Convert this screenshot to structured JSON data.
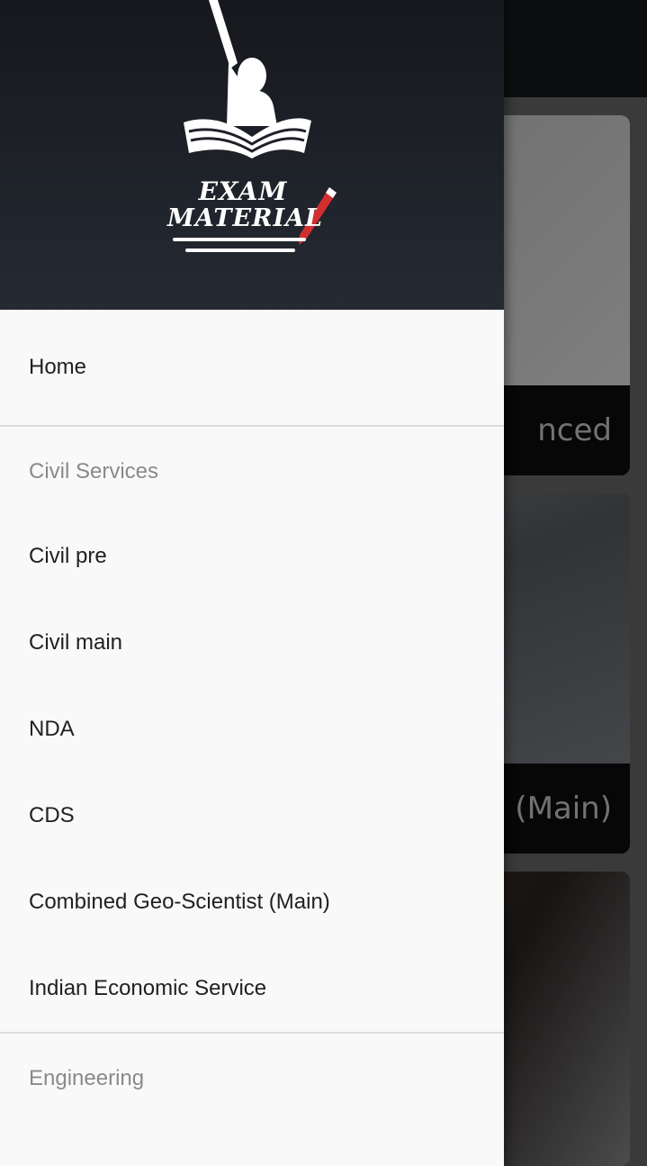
{
  "app": {
    "logo_text_line1": "EXAM",
    "logo_text_line2": "MATERIAL"
  },
  "background": {
    "cards": [
      {
        "caption": "nced"
      },
      {
        "caption": "es (Main)"
      },
      {
        "caption": ""
      }
    ]
  },
  "drawer": {
    "home_label": "Home",
    "sections": [
      {
        "title": "Civil Services",
        "items": [
          "Civil pre",
          "Civil main",
          "NDA",
          "CDS",
          "Combined Geo-Scientist (Main)",
          "Indian Economic Service"
        ]
      },
      {
        "title": "Engineering",
        "items": []
      }
    ]
  },
  "colors": {
    "header_bg_top": "#16181d",
    "header_bg_bottom": "#252a33",
    "drawer_bg": "#f9f9f9",
    "item_text": "#212121",
    "section_text": "#8a8a8a",
    "logo_pencil": "#d32f2f"
  }
}
